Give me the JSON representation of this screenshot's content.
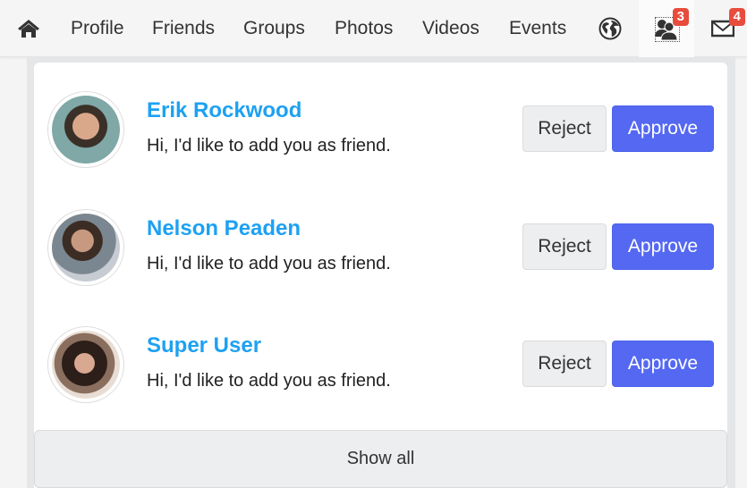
{
  "navbar": {
    "home_icon": "home-icon",
    "items": [
      {
        "label": "Profile"
      },
      {
        "label": "Friends"
      },
      {
        "label": "Groups"
      },
      {
        "label": "Photos"
      },
      {
        "label": "Videos"
      },
      {
        "label": "Events"
      }
    ],
    "globe_icon": "globe-icon",
    "friend_requests": {
      "icon": "friend-requests-icon",
      "badge": "3"
    },
    "messages": {
      "icon": "envelope-icon",
      "badge": "4"
    }
  },
  "requests": [
    {
      "name": "Erik Rockwood",
      "message": "Hi, I'd like to add you as friend.",
      "reject_label": "Reject",
      "approve_label": "Approve"
    },
    {
      "name": "Nelson Peaden",
      "message": "Hi, I'd like to add you as friend.",
      "reject_label": "Reject",
      "approve_label": "Approve"
    },
    {
      "name": "Super User",
      "message": "Hi, I'd like to add you as friend.",
      "reject_label": "Reject",
      "approve_label": "Approve"
    }
  ],
  "show_all_label": "Show all",
  "colors": {
    "accent_name": "#1da1f2",
    "approve": "#5468f2",
    "badge": "#e74c3c"
  }
}
